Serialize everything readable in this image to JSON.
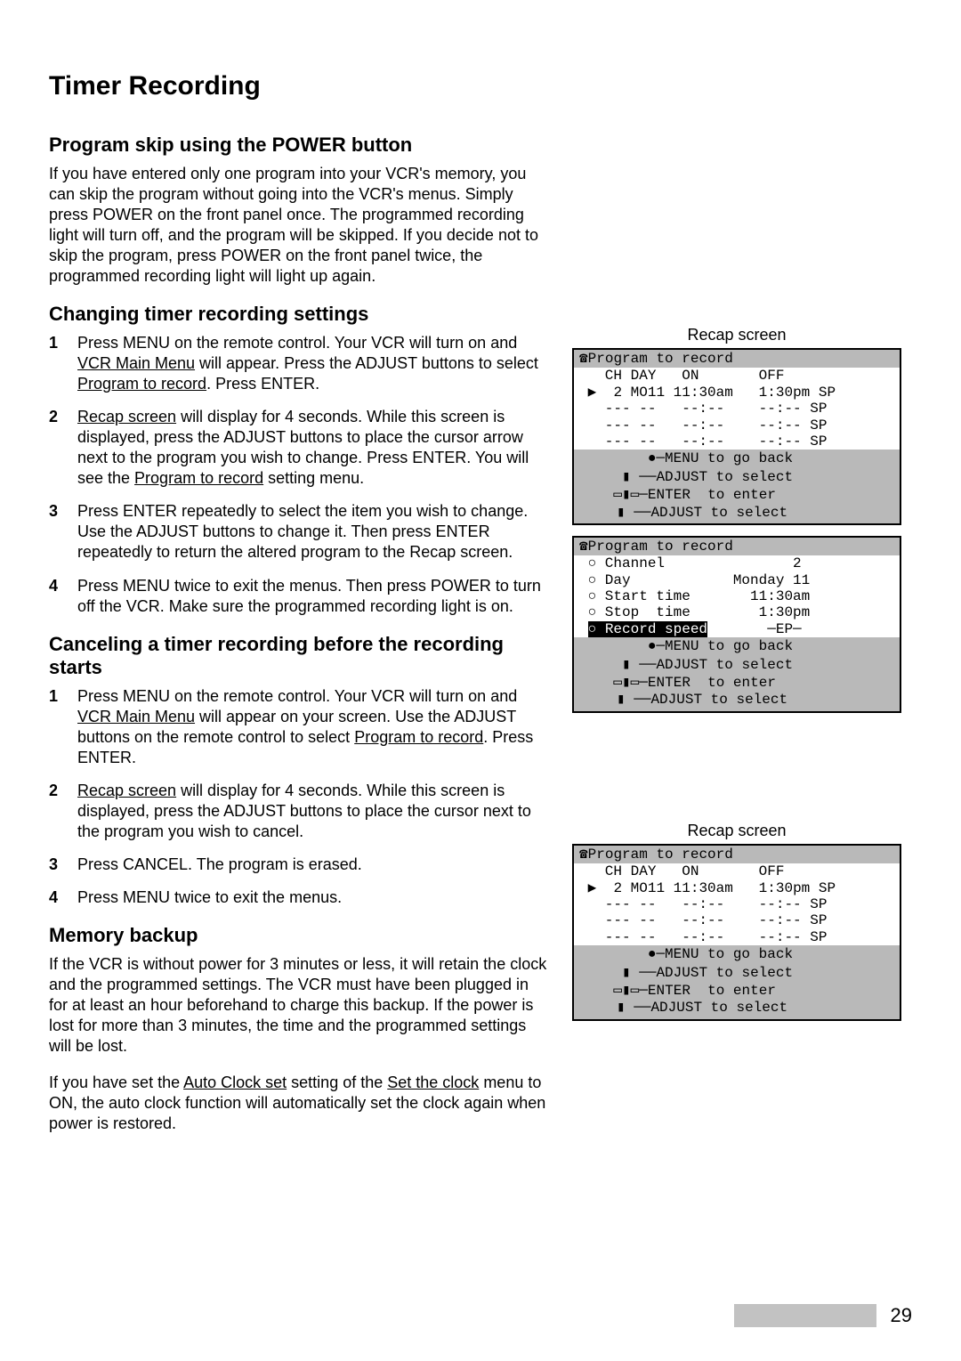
{
  "page": {
    "title": "Timer Recording",
    "number": "29"
  },
  "sections": {
    "skip": {
      "heading": "Program skip using the POWER button",
      "body": "If you have entered only one program into your VCR's memory, you can skip the program without going into the VCR's menus. Simply press POWER on the front panel once.  The programmed recording light will turn off, and the program will be skipped.  If you decide not to skip the program, press POWER on the front panel twice, the programmed recording light will light up again."
    },
    "change": {
      "heading": "Changing timer recording settings",
      "steps": {
        "s1a": "Press MENU on the remote control.  Your VCR will turn on and ",
        "s1b": "VCR Main Menu",
        "s1c": " will appear.  Press the ADJUST buttons to select ",
        "s1d": "Program to record",
        "s1e": ".  Press ENTER.",
        "s2a": "Recap screen",
        "s2b": " will display for 4 seconds.  While this screen is displayed, press the ADJUST buttons to place the cursor arrow next to the program you wish to change.  Press ENTER.  You will see the ",
        "s2c": "Program to record",
        "s2d": " setting menu.",
        "s3": "Press ENTER repeatedly to select the item you wish to change.  Use the ADJUST buttons to change it.  Then press ENTER repeatedly to return the altered program to the Recap screen.",
        "s4": "Press MENU twice to exit the menus.  Then press POWER to turn off the VCR.  Make sure the programmed recording light is on."
      }
    },
    "cancel": {
      "heading": "Canceling a timer recording before the recording starts",
      "steps": {
        "s1a": "Press MENU on the remote control.  Your VCR will turn on and ",
        "s1b": "VCR Main Menu",
        "s1c": " will appear on your screen.  Use the ADJUST buttons on the remote control to select ",
        "s1d": "Program to record",
        "s1e": ".  Press ENTER.",
        "s2a": "Recap screen",
        "s2b": " will display for 4 seconds.  While this screen is displayed, press the ADJUST buttons to place the cursor next to the program you wish to cancel.",
        "s3": "Press CANCEL.  The program is erased.",
        "s4": "Press MENU twice to exit the menus."
      }
    },
    "memory": {
      "heading": "Memory backup",
      "body1": "If the VCR is without power for 3 minutes or less, it will retain the clock and the programmed settings.  The VCR must have been plugged in for at least an hour beforehand to charge this backup.  If the power is lost for more than 3 minutes, the time and the programmed settings will be lost.",
      "body2a": "If you have set the ",
      "body2b": "Auto Clock set",
      "body2c": " setting of the ",
      "body2d": "Set the clock",
      "body2e": " menu to ON, the auto clock function will automatically set the clock again when power is restored."
    }
  },
  "osd": {
    "recap_caption": "Recap screen",
    "recap1_title": "☎Program to record             ",
    "recap1_header": "   CH DAY   ON       OFF       ",
    "recap1_r1": " ▶  2 MO11 11:30am   1:30pm SP ",
    "recap1_r2": "   --- --   --:--    --:-- SP ",
    "recap1_r3": "   --- --   --:--    --:-- SP ",
    "recap1_r4": "   --- --   --:--    --:-- SP ",
    "hints_menu": "        ●─MENU to go back      ",
    "hints_adj1": "     ▮ ──ADJUST to select      ",
    "hints_enter": "    ▭▮▭─ENTER  to enter        ",
    "hints_adj2": "     ▮ ──ADJUST to select      ",
    "prog_title": "☎Program to record             ",
    "prog_ch": " ○ Channel               2     ",
    "prog_day": " ○ Day            Monday 11    ",
    "prog_start": " ○ Start time       11:30am    ",
    "prog_stop": " ○ Stop  time        1:30pm    ",
    "prog_speed_a": " ",
    "prog_speed_b": "○ Record speed",
    "prog_speed_c": "       ─EP─   ",
    "recap2_title": "☎Program to record             ",
    "recap2_header": "   CH DAY   ON       OFF       ",
    "recap2_r1": " ▶  2 MO11 11:30am   1:30pm SP ",
    "recap2_r2": "   --- --   --:--    --:-- SP ",
    "recap2_r3": "   --- --   --:--    --:-- SP ",
    "recap2_r4": "   --- --   --:--    --:-- SP "
  }
}
